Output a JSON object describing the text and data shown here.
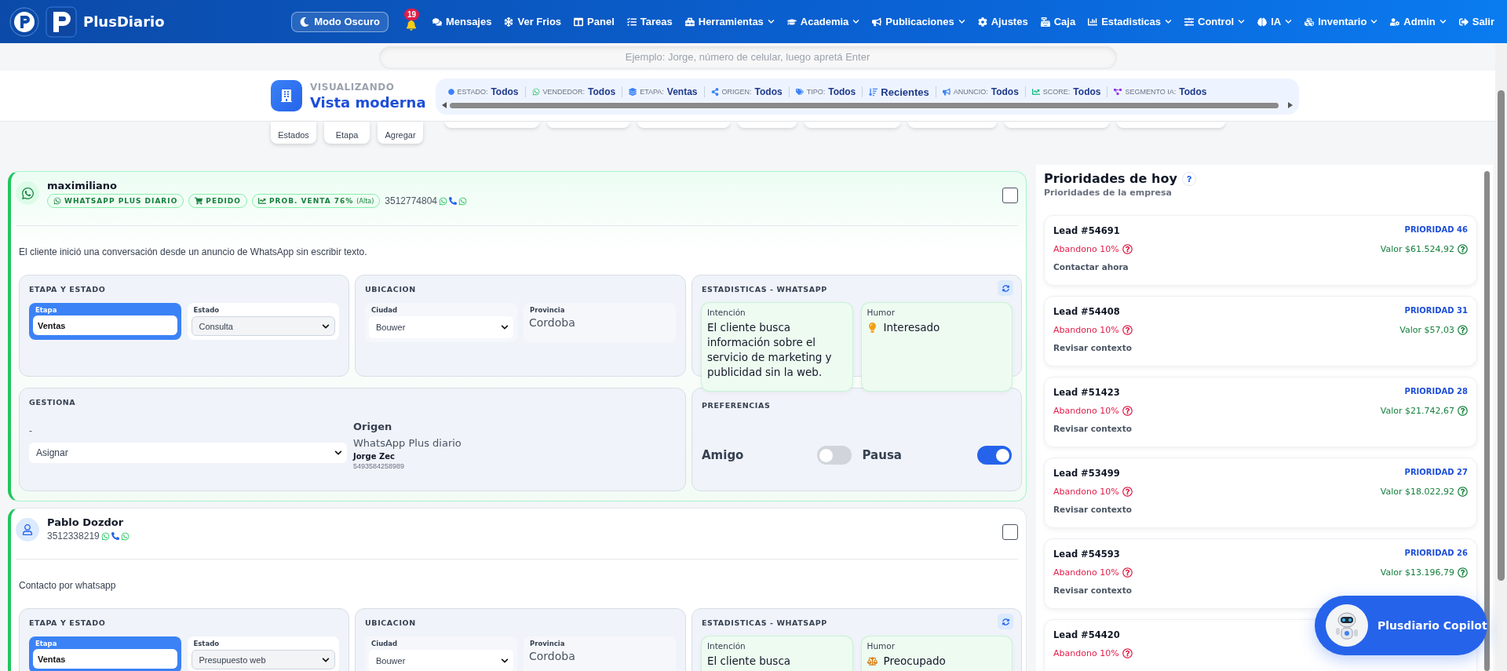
{
  "app": {
    "name": "PlusDiario"
  },
  "nav": {
    "dark_mode": "Modo Oscuro",
    "notifications": "19",
    "items": [
      {
        "label": "Mensajes",
        "dropdown": false
      },
      {
        "label": "Ver Frios",
        "dropdown": false
      },
      {
        "label": "Panel",
        "dropdown": false
      },
      {
        "label": "Tareas",
        "dropdown": false
      },
      {
        "label": "Herramientas",
        "dropdown": true
      },
      {
        "label": "Academia",
        "dropdown": true
      },
      {
        "label": "Publicaciones",
        "dropdown": true
      },
      {
        "label": "Ajustes",
        "dropdown": false
      },
      {
        "label": "Caja",
        "dropdown": false
      },
      {
        "label": "Estadisticas",
        "dropdown": true
      },
      {
        "label": "Control",
        "dropdown": true
      },
      {
        "label": "IA",
        "dropdown": true
      },
      {
        "label": "Inventario",
        "dropdown": true
      },
      {
        "label": "Admin",
        "dropdown": true
      },
      {
        "label": "Salir",
        "dropdown": false
      }
    ]
  },
  "search": {
    "placeholder": "Ejemplo: Jorge, número de celular, luego apretá Enter"
  },
  "view": {
    "caption": "VISUALIZANDO",
    "title": "Vista moderna"
  },
  "filters": [
    {
      "kind": "filter",
      "label": "ESTADO:",
      "value": "Todos"
    },
    {
      "kind": "filter",
      "label": "VENDEDOR:",
      "value": "Todos"
    },
    {
      "kind": "filter",
      "label": "ETAPA:",
      "value": "Ventas"
    },
    {
      "kind": "filter",
      "label": "ORIGEN:",
      "value": "Todos"
    },
    {
      "kind": "filter",
      "label": "TIPO:",
      "value": "Todos"
    },
    {
      "kind": "sort",
      "value": "Recientes"
    },
    {
      "kind": "filter",
      "label": "ANUNCIO:",
      "value": "Todos"
    },
    {
      "kind": "filter",
      "label": "SCORE:",
      "value": "Todos"
    },
    {
      "kind": "filter",
      "label": "SEGMENTO IA:",
      "value": "Todos"
    }
  ],
  "tools": [
    "Estados",
    "Etapa",
    "Agregar"
  ],
  "leads": [
    {
      "kind": "whatsapp",
      "highlighted": true,
      "selected": false,
      "name": "maximiliano",
      "tags": [
        {
          "label": "WHATSAPP PLUS DIARIO"
        },
        {
          "label": "PEDIDO"
        },
        {
          "label": "PROB. VENTA 76%",
          "note": "(Alta)"
        }
      ],
      "phone": "3512774804",
      "note": "El cliente inició una conversación desde un anuncio de WhatsApp sin escribir texto.",
      "stage_panel": {
        "title": "ETAPA Y ESTADO",
        "stage_label": "Etapa",
        "stage": "Ventas",
        "status_label": "Estado",
        "status": "Consulta"
      },
      "location": {
        "title": "UBICACION",
        "city_label": "Ciudad",
        "city": "Bouwer",
        "province_label": "Provincia",
        "province": "Cordoba"
      },
      "stats": {
        "title": "ESTADISTICAS - WHATSAPP",
        "intent_label": "Intención",
        "intent": "El cliente busca información sobre el servicio de marketing y publicidad sin la web.",
        "mood_label": "Humor",
        "mood": "Interesado"
      },
      "manager": {
        "title": "GESTIONA",
        "current": "-",
        "select": "Asignar",
        "origin_label": "Origen",
        "origin": "WhatsApp Plus diario",
        "contact": "Jorge Zec",
        "contact_phone": "5493584258989"
      },
      "preferences": {
        "title": "PREFERENCIAS",
        "toggles": [
          {
            "label": "Amigo",
            "on": false
          },
          {
            "label": "Pausa",
            "on": true
          }
        ]
      }
    },
    {
      "kind": "contact",
      "highlighted": false,
      "selected": false,
      "name": "Pablo Dozdor",
      "phone": "3512338219",
      "note": "Contacto por whatsapp",
      "stage_panel": {
        "title": "ETAPA Y ESTADO",
        "stage_label": "Etapa",
        "stage": "Ventas",
        "status_label": "Estado",
        "status": "Presupuesto web"
      },
      "location": {
        "title": "UBICACION",
        "city_label": "Ciudad",
        "city": "Bouwer",
        "province_label": "Provincia",
        "province": "Cordoba"
      },
      "stats": {
        "title": "ESTADISTICAS - WHATSAPP",
        "intent_label": "Intención",
        "intent": "El cliente busca",
        "mood_label": "Humor",
        "mood": "Preocupado"
      }
    }
  ],
  "priorities": {
    "title": "Prioridades de hoy",
    "subtitle": "Prioridades de la empresa",
    "items": [
      {
        "lead": "Lead #54691",
        "priority": "PRIORIDAD 46",
        "risk": "Abandono 10%",
        "value": "Valor $61.524,92",
        "action": "Contactar ahora"
      },
      {
        "lead": "Lead #54408",
        "priority": "PRIORIDAD 31",
        "risk": "Abandono 10%",
        "value": "Valor $57,03",
        "action": "Revisar contexto"
      },
      {
        "lead": "Lead #51423",
        "priority": "PRIORIDAD 28",
        "risk": "Abandono 10%",
        "value": "Valor $21.742,67",
        "action": "Revisar contexto"
      },
      {
        "lead": "Lead #53499",
        "priority": "PRIORIDAD 27",
        "risk": "Abandono 10%",
        "value": "Valor $18.022,92",
        "action": "Revisar contexto"
      },
      {
        "lead": "Lead #54593",
        "priority": "PRIORIDAD 26",
        "risk": "Abandono 10%",
        "value": "Valor $13.196,79",
        "action": "Revisar contexto"
      },
      {
        "lead": "Lead #54420",
        "risk": "Abandono 10%"
      }
    ]
  },
  "copilot": {
    "label": "Plusdiario Copilot"
  }
}
